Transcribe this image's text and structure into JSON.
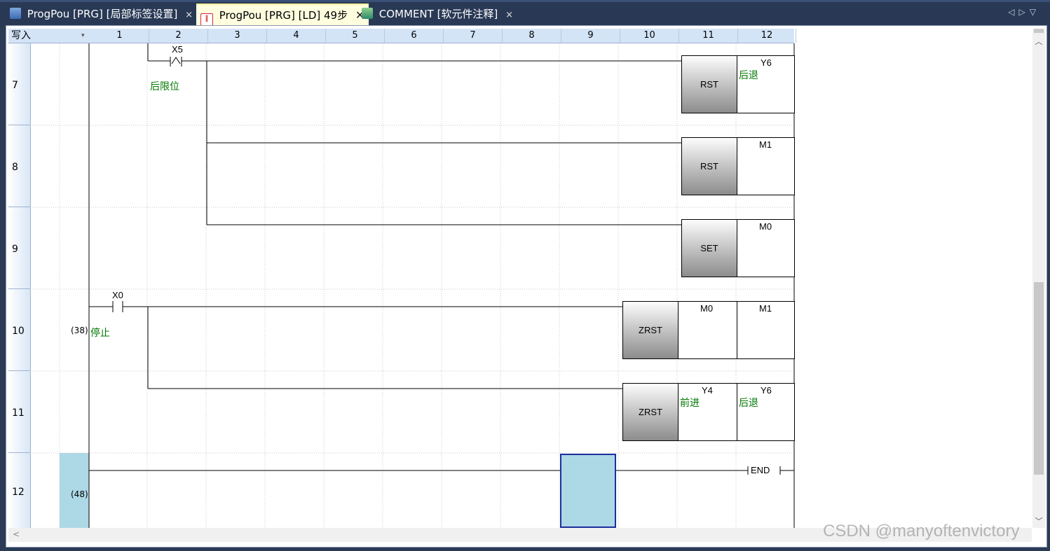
{
  "tabs": [
    {
      "label": "ProgPou [PRG] [局部标签设置]",
      "icon": "label-table-icon",
      "close": "×"
    },
    {
      "label": "ProgPou [PRG] [LD] 49步",
      "icon": "ladder-program-icon",
      "close": "✕"
    },
    {
      "label": "COMMENT [软元件注释]",
      "icon": "comment-icon",
      "close": "×"
    }
  ],
  "tab_nav": {
    "prev": "◁",
    "next": "▷",
    "menu": "▽"
  },
  "header": {
    "mode": "写入",
    "dropdown": "▾",
    "columns": [
      "1",
      "2",
      "3",
      "4",
      "5",
      "6",
      "7",
      "8",
      "9",
      "10",
      "11",
      "12"
    ]
  },
  "rows": [
    {
      "num": "7"
    },
    {
      "num": "8"
    },
    {
      "num": "9"
    },
    {
      "num": "10"
    },
    {
      "num": "11"
    },
    {
      "num": "12"
    }
  ],
  "ladder": {
    "x5": {
      "device": "X5",
      "comment": "后限位"
    },
    "x0": {
      "device": "X0",
      "comment": "停止",
      "step": "(38)"
    },
    "end_step": "(48)",
    "rst_y6": {
      "instr": "RST",
      "dev": "Y6",
      "comment": "后退"
    },
    "rst_m1": {
      "instr": "RST",
      "dev": "M1"
    },
    "set_m0": {
      "instr": "SET",
      "dev": "M0"
    },
    "zrst1": {
      "instr": "ZRST",
      "dev1": "M0",
      "dev2": "M1"
    },
    "zrst2": {
      "instr": "ZRST",
      "dev1": "Y4",
      "comment1": "前进",
      "dev2": "Y6",
      "comment2": "后退"
    },
    "end": "END"
  },
  "watermark": "CSDN @manyoftenvictory",
  "colors": {
    "tabbar": "#293955",
    "active_tab": "#ffffe0",
    "comment_green": "#007800",
    "cursor": "#add8e6"
  }
}
